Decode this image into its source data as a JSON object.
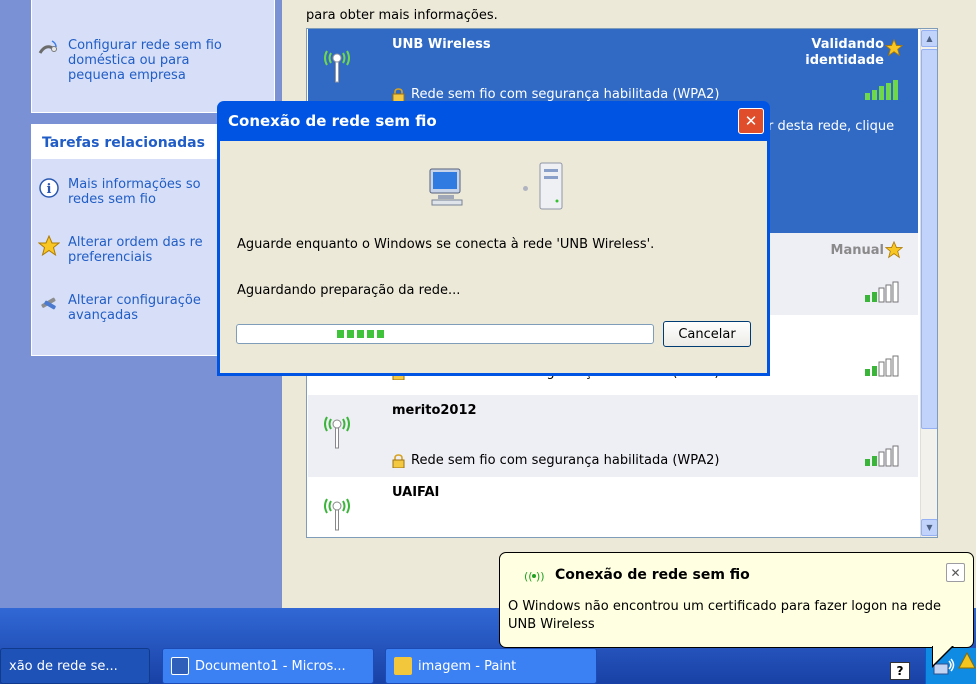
{
  "left_pane": {
    "top_task": {
      "label": "Configurar rede sem fio doméstica ou para pequena empresa",
      "icon": "wizard-icon"
    },
    "related": {
      "header": "Tarefas relacionadas",
      "items": [
        {
          "label": "Mais informações so\nredes sem fio",
          "icon": "info-icon"
        },
        {
          "label": "Alterar ordem das re\npreferenciais",
          "icon": "star-icon"
        },
        {
          "label": "Alterar configuraçõe\navançadas",
          "icon": "tools-icon"
        }
      ]
    }
  },
  "list": {
    "intro": "para obter mais informações.",
    "networks": [
      {
        "name": "UNB Wireless",
        "status": "Validando\nidentidade",
        "security": "Rede sem fio com segurança habilitada (WPA2)",
        "selected": true,
        "desc_tail": "r desta rede, clique"
      },
      {
        "name": "",
        "status": "Manual",
        "security": "",
        "selected": false
      },
      {
        "name": "",
        "status": "",
        "security": "Rede sem fio com segurança habilitada (WPA2)",
        "selected": false
      },
      {
        "name": "merito2012",
        "status": "",
        "security": "Rede sem fio com segurança habilitada (WPA2)",
        "selected": false
      },
      {
        "name": "UAIFAI",
        "status": "",
        "security": "",
        "selected": false
      }
    ]
  },
  "dialog": {
    "title": "Conexão de rede sem fio",
    "message": "Aguarde enquanto o Windows se conecta à rede 'UNB Wireless'.",
    "status": "Aguardando preparação da rede...",
    "cancel_label": "Cancelar"
  },
  "balloon": {
    "title": "Conexão de rede sem fio",
    "text": "O Windows não encontrou um certificado para fazer logon na rede UNB Wireless"
  },
  "taskbar": {
    "buttons": [
      {
        "label": "xão de rede se..."
      },
      {
        "label": "Documento1 - Micros..."
      },
      {
        "label": "imagem - Paint"
      }
    ],
    "help_label": "?"
  },
  "colors": {
    "selection": "#316ac5",
    "accent": "#0054e3",
    "taskbar": "#245edb"
  }
}
